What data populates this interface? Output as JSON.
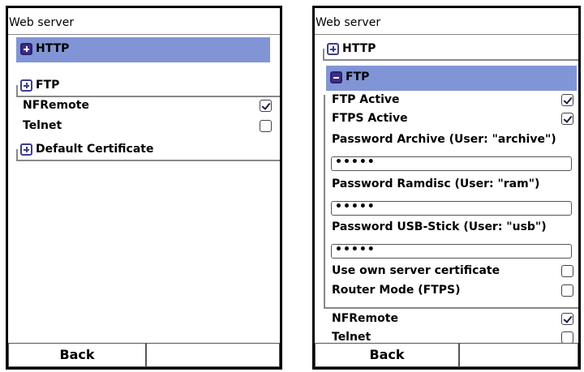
{
  "left": {
    "title": "Web server",
    "groups": [
      {
        "label": "HTTP",
        "state": "collapsed",
        "selected": true
      },
      {
        "label": "FTP",
        "state": "collapsed",
        "selected": false
      },
      {
        "label": "Default Certificate",
        "state": "collapsed",
        "selected": false
      }
    ],
    "rows": [
      {
        "label": "NFRemote",
        "checked": true
      },
      {
        "label": "Telnet",
        "checked": false
      }
    ],
    "softkeys": {
      "left": "Back",
      "right": ""
    }
  },
  "right": {
    "title": "Web server",
    "groups": [
      {
        "label": "HTTP",
        "state": "collapsed",
        "selected": false
      },
      {
        "label": "FTP",
        "state": "expanded",
        "selected": true
      }
    ],
    "ftp": {
      "ftp_active": {
        "label": "FTP Active",
        "checked": true
      },
      "ftps_active": {
        "label": "FTPS Active",
        "checked": true
      },
      "password_archive": {
        "label": "Password Archive (User: \"archive\")",
        "value": "•••••"
      },
      "password_ramdisc": {
        "label": "Password Ramdisc (User: \"ram\")",
        "value": "•••••"
      },
      "password_usb": {
        "label": "Password USB-Stick (User: \"usb\")",
        "value": "•••••"
      },
      "own_certificate": {
        "label": "Use own server certificate",
        "checked": false
      },
      "router_mode": {
        "label": "Router Mode (FTPS)",
        "checked": false
      }
    },
    "rows": [
      {
        "label": "NFRemote",
        "checked": true
      },
      {
        "label": "Telnet",
        "checked": false
      }
    ],
    "softkeys": {
      "left": "Back",
      "right": ""
    }
  },
  "colors": {
    "selection": "#8195d6",
    "icon_fill": "#3d2e8c",
    "divider": "#888888"
  },
  "icons": {
    "collapsed": "plus-box-icon",
    "expanded": "minus-box-icon",
    "checked": "checkmark-icon"
  }
}
